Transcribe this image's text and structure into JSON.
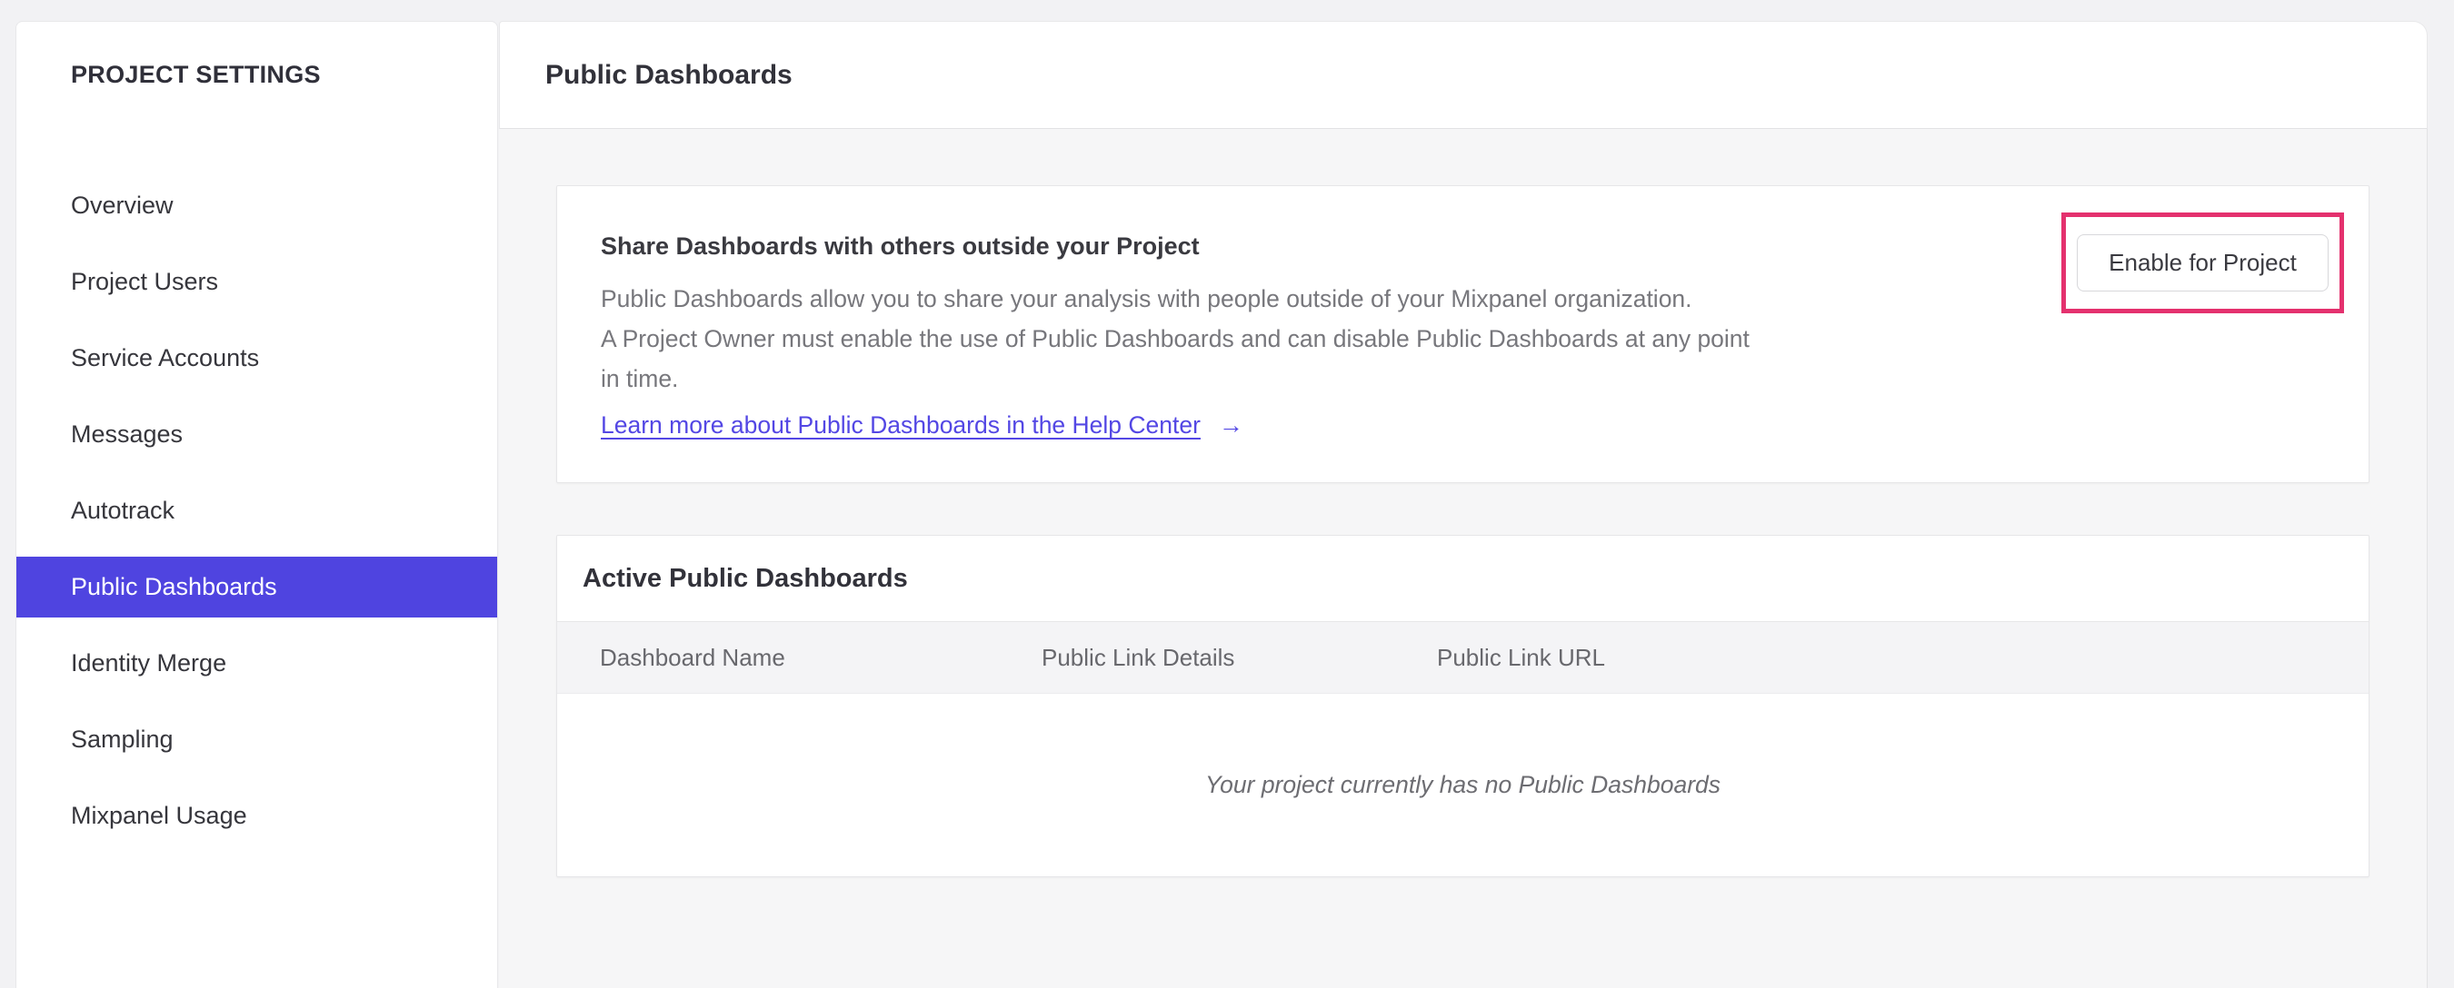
{
  "sidebar": {
    "header": "PROJECT SETTINGS",
    "items": [
      {
        "label": "Overview"
      },
      {
        "label": "Project Users"
      },
      {
        "label": "Service Accounts"
      },
      {
        "label": "Messages"
      },
      {
        "label": "Autotrack"
      },
      {
        "label": "Public Dashboards",
        "selected": true
      },
      {
        "label": "Identity Merge"
      },
      {
        "label": "Sampling"
      },
      {
        "label": "Mixpanel Usage"
      }
    ]
  },
  "header": {
    "title": "Public Dashboards"
  },
  "share_card": {
    "title": "Share Dashboards with others outside your Project",
    "body_lines": [
      "Public Dashboards allow you to share your analysis with people outside of your Mixpanel organization.",
      "A Project Owner must enable the use of Public Dashboards and can disable Public Dashboards at any point",
      "in time."
    ],
    "link_label": "Learn more about Public Dashboards in the Help Center",
    "arrow_icon": "→",
    "enable_button_label": "Enable for Project"
  },
  "active_card": {
    "title": "Active Public Dashboards",
    "columns": [
      "Dashboard Name",
      "Public Link Details",
      "Public Link URL"
    ],
    "empty_message": "Your project currently has no Public Dashboards"
  },
  "colors": {
    "accent": "#4f44e0",
    "link": "#5347e4",
    "highlight": "#e4316e"
  }
}
